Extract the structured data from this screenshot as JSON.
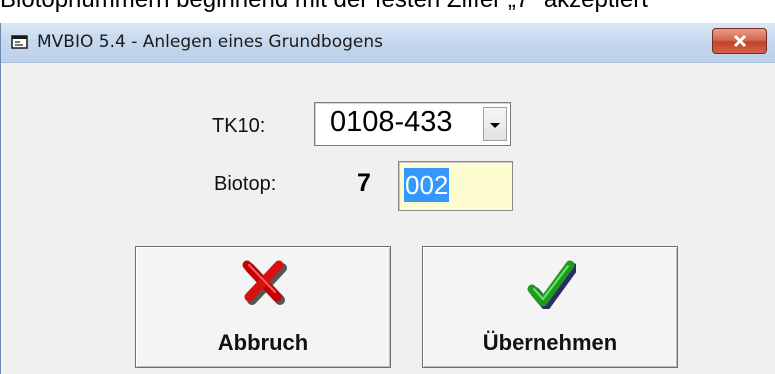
{
  "document": {
    "partial_text": "Biotopnummern beginnend mit der festen Ziffer „7“ akzeptiert"
  },
  "window": {
    "title": "MVBIO 5.4 - Anlegen eines Grundbogens",
    "title_icon": "window-app-icon",
    "close_icon": "close-icon"
  },
  "form": {
    "tk10_label": "TK10:",
    "tk10_value": "0108-433",
    "biotop_label": "Biotop:",
    "biotop_prefix": "7",
    "biotop_value": "002"
  },
  "buttons": {
    "cancel_label": "Abbruch",
    "cancel_icon": "red-x-icon",
    "accept_label": "Übernehmen",
    "accept_icon": "green-checkmark-icon"
  },
  "colors": {
    "biotop_field_bg": "#fdfbd0",
    "selection": "#3399ff",
    "close_button": "#c0432a"
  }
}
